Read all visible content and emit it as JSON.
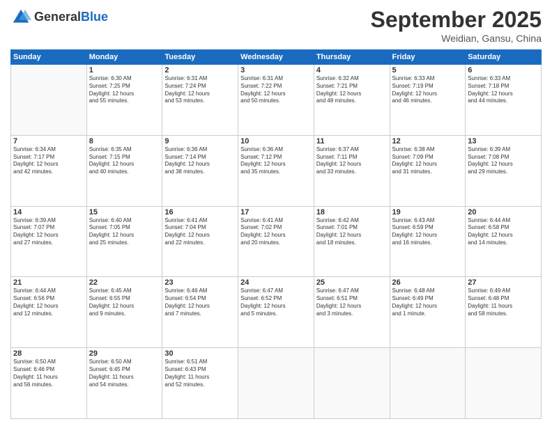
{
  "logo": {
    "general": "General",
    "blue": "Blue"
  },
  "header": {
    "month": "September 2025",
    "location": "Weidian, Gansu, China"
  },
  "weekdays": [
    "Sunday",
    "Monday",
    "Tuesday",
    "Wednesday",
    "Thursday",
    "Friday",
    "Saturday"
  ],
  "weeks": [
    [
      {
        "day": "",
        "info": ""
      },
      {
        "day": "1",
        "info": "Sunrise: 6:30 AM\nSunset: 7:25 PM\nDaylight: 12 hours\nand 55 minutes."
      },
      {
        "day": "2",
        "info": "Sunrise: 6:31 AM\nSunset: 7:24 PM\nDaylight: 12 hours\nand 53 minutes."
      },
      {
        "day": "3",
        "info": "Sunrise: 6:31 AM\nSunset: 7:22 PM\nDaylight: 12 hours\nand 50 minutes."
      },
      {
        "day": "4",
        "info": "Sunrise: 6:32 AM\nSunset: 7:21 PM\nDaylight: 12 hours\nand 48 minutes."
      },
      {
        "day": "5",
        "info": "Sunrise: 6:33 AM\nSunset: 7:19 PM\nDaylight: 12 hours\nand 46 minutes."
      },
      {
        "day": "6",
        "info": "Sunrise: 6:33 AM\nSunset: 7:18 PM\nDaylight: 12 hours\nand 44 minutes."
      }
    ],
    [
      {
        "day": "7",
        "info": "Sunrise: 6:34 AM\nSunset: 7:17 PM\nDaylight: 12 hours\nand 42 minutes."
      },
      {
        "day": "8",
        "info": "Sunrise: 6:35 AM\nSunset: 7:15 PM\nDaylight: 12 hours\nand 40 minutes."
      },
      {
        "day": "9",
        "info": "Sunrise: 6:36 AM\nSunset: 7:14 PM\nDaylight: 12 hours\nand 38 minutes."
      },
      {
        "day": "10",
        "info": "Sunrise: 6:36 AM\nSunset: 7:12 PM\nDaylight: 12 hours\nand 35 minutes."
      },
      {
        "day": "11",
        "info": "Sunrise: 6:37 AM\nSunset: 7:11 PM\nDaylight: 12 hours\nand 33 minutes."
      },
      {
        "day": "12",
        "info": "Sunrise: 6:38 AM\nSunset: 7:09 PM\nDaylight: 12 hours\nand 31 minutes."
      },
      {
        "day": "13",
        "info": "Sunrise: 6:39 AM\nSunset: 7:08 PM\nDaylight: 12 hours\nand 29 minutes."
      }
    ],
    [
      {
        "day": "14",
        "info": "Sunrise: 6:39 AM\nSunset: 7:07 PM\nDaylight: 12 hours\nand 27 minutes."
      },
      {
        "day": "15",
        "info": "Sunrise: 6:40 AM\nSunset: 7:05 PM\nDaylight: 12 hours\nand 25 minutes."
      },
      {
        "day": "16",
        "info": "Sunrise: 6:41 AM\nSunset: 7:04 PM\nDaylight: 12 hours\nand 22 minutes."
      },
      {
        "day": "17",
        "info": "Sunrise: 6:41 AM\nSunset: 7:02 PM\nDaylight: 12 hours\nand 20 minutes."
      },
      {
        "day": "18",
        "info": "Sunrise: 6:42 AM\nSunset: 7:01 PM\nDaylight: 12 hours\nand 18 minutes."
      },
      {
        "day": "19",
        "info": "Sunrise: 6:43 AM\nSunset: 6:59 PM\nDaylight: 12 hours\nand 16 minutes."
      },
      {
        "day": "20",
        "info": "Sunrise: 6:44 AM\nSunset: 6:58 PM\nDaylight: 12 hours\nand 14 minutes."
      }
    ],
    [
      {
        "day": "21",
        "info": "Sunrise: 6:44 AM\nSunset: 6:56 PM\nDaylight: 12 hours\nand 12 minutes."
      },
      {
        "day": "22",
        "info": "Sunrise: 6:45 AM\nSunset: 6:55 PM\nDaylight: 12 hours\nand 9 minutes."
      },
      {
        "day": "23",
        "info": "Sunrise: 6:46 AM\nSunset: 6:54 PM\nDaylight: 12 hours\nand 7 minutes."
      },
      {
        "day": "24",
        "info": "Sunrise: 6:47 AM\nSunset: 6:52 PM\nDaylight: 12 hours\nand 5 minutes."
      },
      {
        "day": "25",
        "info": "Sunrise: 6:47 AM\nSunset: 6:51 PM\nDaylight: 12 hours\nand 3 minutes."
      },
      {
        "day": "26",
        "info": "Sunrise: 6:48 AM\nSunset: 6:49 PM\nDaylight: 12 hours\nand 1 minute."
      },
      {
        "day": "27",
        "info": "Sunrise: 6:49 AM\nSunset: 6:48 PM\nDaylight: 11 hours\nand 58 minutes."
      }
    ],
    [
      {
        "day": "28",
        "info": "Sunrise: 6:50 AM\nSunset: 6:46 PM\nDaylight: 11 hours\nand 56 minutes."
      },
      {
        "day": "29",
        "info": "Sunrise: 6:50 AM\nSunset: 6:45 PM\nDaylight: 11 hours\nand 54 minutes."
      },
      {
        "day": "30",
        "info": "Sunrise: 6:51 AM\nSunset: 6:43 PM\nDaylight: 11 hours\nand 52 minutes."
      },
      {
        "day": "",
        "info": ""
      },
      {
        "day": "",
        "info": ""
      },
      {
        "day": "",
        "info": ""
      },
      {
        "day": "",
        "info": ""
      }
    ]
  ]
}
